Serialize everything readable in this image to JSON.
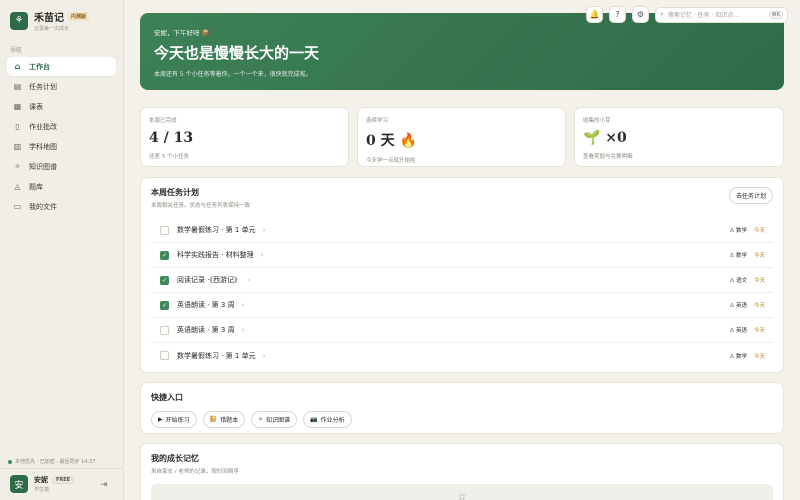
{
  "brand": {
    "name": "禾苗记",
    "badge": "内测版",
    "subtitle": "记录每一次成长"
  },
  "nav": {
    "title": "导航",
    "items": [
      {
        "label": "工作台",
        "icon": "home-icon",
        "glyph": "⌂",
        "active": true
      },
      {
        "label": "任务计划",
        "icon": "clipboard-icon",
        "glyph": "▤",
        "active": false
      },
      {
        "label": "课表",
        "icon": "calendar-icon",
        "glyph": "▦",
        "active": false
      },
      {
        "label": "作业批改",
        "icon": "document-icon",
        "glyph": "▯",
        "active": false
      },
      {
        "label": "学科地图",
        "icon": "map-icon",
        "glyph": "▥",
        "active": false
      },
      {
        "label": "知识图谱",
        "icon": "sparkle-icon",
        "glyph": "✧",
        "active": false
      },
      {
        "label": "题库",
        "icon": "graduation-cap-icon",
        "glyph": "◬",
        "active": false
      },
      {
        "label": "我的文件",
        "icon": "folder-icon",
        "glyph": "▭",
        "active": false
      }
    ]
  },
  "sync_status": "本地优先 · 已加密 · 最后同步 14:37",
  "user": {
    "avatar": "安",
    "name": "安妮",
    "plan": "FREE",
    "role": "学生端"
  },
  "search": {
    "placeholder": "搜索记忆 · 任务 · 知识点…",
    "shortcut": "⌘K"
  },
  "hero": {
    "greeting": "安妮，下午好呀 📦",
    "title": "今天也是慢慢长大的一天",
    "subtitle": "本周还有 5 个小任务等着你。一个一个来，很快就完成啦。"
  },
  "stats": [
    {
      "label": "本周已完成",
      "value": "4 / 13",
      "hint": "还差 5 个小任务"
    },
    {
      "label": "连续学习",
      "value": "0 天 🔥",
      "hint": "今天学一点就开始啦"
    },
    {
      "label": "收集的小芽",
      "value": "🌱 ×0",
      "hint": "查看奖励与兑换明细"
    }
  ],
  "tasks": {
    "title": "本周任务计划",
    "subtitle": "本周相关任务。状态与任务列表保持一致",
    "goto_label": "去任务计划",
    "items": [
      {
        "name": "数学暑假练习 · 第 1 单元",
        "done": false,
        "subject": "数学",
        "due": "今天"
      },
      {
        "name": "科学实践报告 · 材料整理",
        "done": true,
        "subject": "数学",
        "due": "今天"
      },
      {
        "name": "阅读记录 ·《西游记》",
        "done": true,
        "subject": "语文",
        "due": "今天"
      },
      {
        "name": "英语朗读 · 第 3 周",
        "done": true,
        "subject": "英语",
        "due": "今天"
      },
      {
        "name": "英语朗读 · 第 3 周",
        "done": false,
        "subject": "英语",
        "due": "今天"
      },
      {
        "name": "数学暑假练习 · 第 1 单元",
        "done": false,
        "subject": "数学",
        "due": "今天"
      }
    ]
  },
  "quick": {
    "title": "快捷入口",
    "items": [
      {
        "label": "开始练习",
        "icon": "play-icon",
        "glyph": "▶"
      },
      {
        "label": "错题本",
        "icon": "book-icon",
        "glyph": "📔"
      },
      {
        "label": "知识图谱",
        "icon": "sparkle-icon",
        "glyph": "✧"
      },
      {
        "label": "作业分析",
        "icon": "camera-icon",
        "glyph": "📷"
      }
    ]
  },
  "growth": {
    "title": "我的成长记忆",
    "subtitle": "来自家长 / 老师的记录，按时间倒序"
  },
  "colors": {
    "accent": "#2f6b48",
    "due": "#b07a1f",
    "background": "#f3f1ea"
  }
}
